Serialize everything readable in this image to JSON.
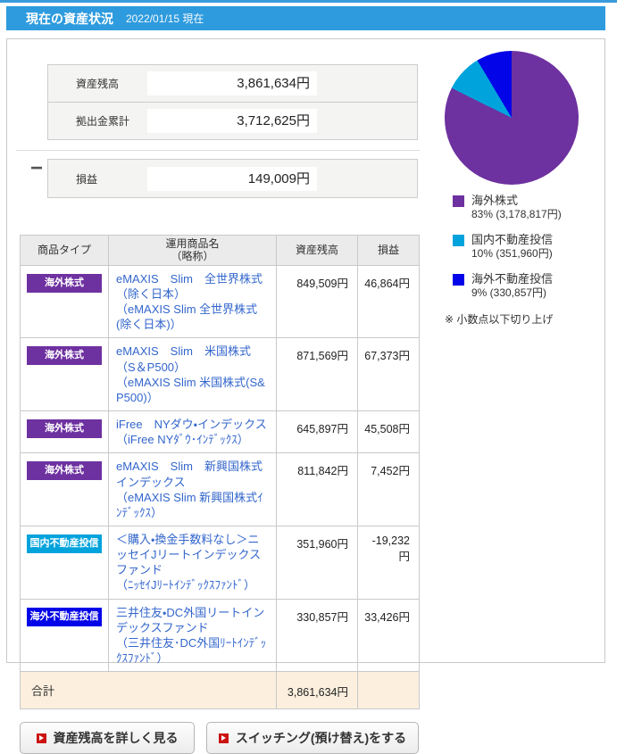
{
  "header": {
    "title": "現在の資産状況",
    "date": "2022/01/15 現在"
  },
  "summary": {
    "balance_label": "資産残高",
    "balance_value": "3,861,634円",
    "operator": "−",
    "contribution_label": "拠出金累計",
    "contribution_value": "3,712,625円",
    "pl_label": "損益",
    "pl_value": "149,009円"
  },
  "chart_data": {
    "type": "pie",
    "start_angle": "top-clockwise",
    "legend_position": "below",
    "slices": [
      {
        "label": "海外株式",
        "value": 3178817,
        "percent": "83%",
        "value_label": "3,178,817円",
        "legend_detail": "83% (3,178,817円)",
        "color": "#6E31A0"
      },
      {
        "label": "国内不動産投信",
        "value": 351960,
        "percent": "10%",
        "value_label": "351,960円",
        "legend_detail": "10% (351,960円)",
        "color": "#00A3DC"
      },
      {
        "label": "海外不動産投信",
        "value": 330857,
        "percent": "9%",
        "value_label": "330,857円",
        "legend_detail": "9% (330,857円)",
        "color": "#0404E8"
      }
    ],
    "note": "※ 小数点以下切り上げ"
  },
  "table": {
    "col_type": "商品タイプ",
    "col_name_line1": "運用商品名",
    "col_name_line2": "（略称）",
    "col_balance": "資産残高",
    "col_pl": "損益",
    "rows": [
      {
        "type": "海外株式",
        "type_color": "#6E31A0",
        "name": "eMAXIS　Slim　全世界株式（除く日本）",
        "short_name": "（eMAXIS Slim 全世界株式(除く日本)）",
        "balance": "849,509円",
        "pl": "46,864円"
      },
      {
        "type": "海外株式",
        "type_color": "#6E31A0",
        "name": "eMAXIS　Slim　米国株式（S＆P500）",
        "short_name": "（eMAXIS Slim 米国株式(S&P500)）",
        "balance": "871,569円",
        "pl": "67,373円"
      },
      {
        "type": "海外株式",
        "type_color": "#6E31A0",
        "name": "iFree　NYダウ・インデックス",
        "short_name": "（iFree NYﾀﾞｳ･ｲﾝﾃﾞｯｸｽ）",
        "balance": "645,897円",
        "pl": "45,508円"
      },
      {
        "type": "海外株式",
        "type_color": "#6E31A0",
        "name": "eMAXIS　Slim　新興国株式インデックス",
        "short_name": "（eMAXIS Slim 新興国株式ｲﾝﾃﾞｯｸｽ）",
        "balance": "811,842円",
        "pl": "7,452円"
      },
      {
        "type": "国内不動産投信",
        "type_color": "#00A3DC",
        "name": "＜購入・換金手数料なし＞ニッセイJリートインデックスファンド",
        "short_name": "（ﾆｯｾｲJﾘｰﾄｲﾝﾃﾞｯｸｽﾌｧﾝﾄﾞ）",
        "balance": "351,960円",
        "pl": "-19,232円"
      },
      {
        "type": "海外不動産投信",
        "type_color": "#0404E8",
        "name": "三井住友・DC外国リートインデックスファンド",
        "short_name": "（三井住友･DC外国ﾘｰﾄｲﾝﾃﾞｯｸｽﾌｧﾝﾄﾞ）",
        "balance": "330,857円",
        "pl": "33,426円"
      }
    ],
    "total_label": "合計",
    "total_balance": "3,861,634円"
  },
  "buttons": {
    "detail_label": "資産残高を詳しく見る",
    "switching_label": "スイッチング(預け替え)をする"
  }
}
